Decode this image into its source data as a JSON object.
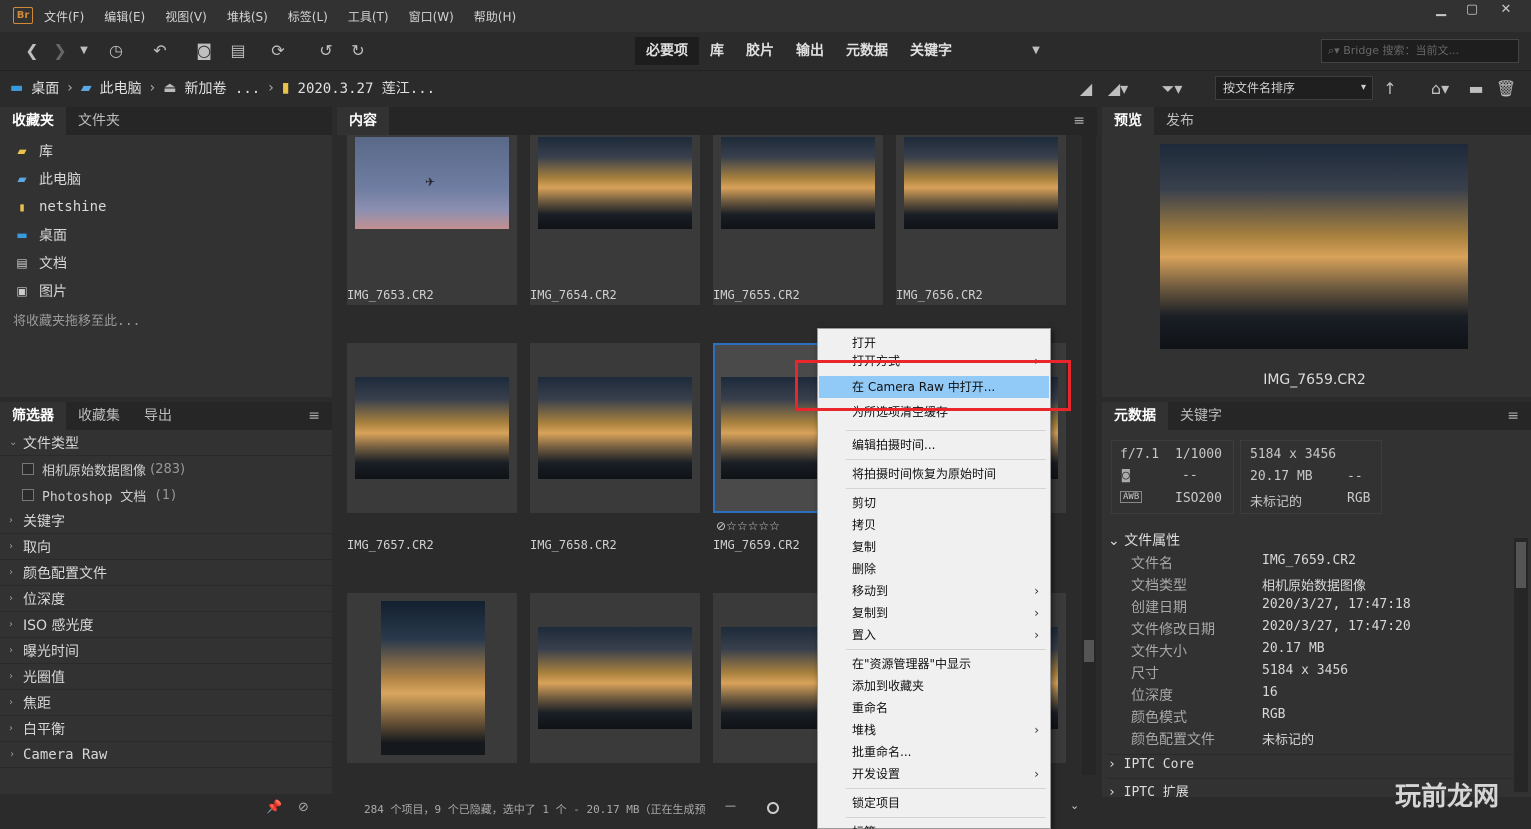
{
  "app": {
    "logo": "Br"
  },
  "menu": [
    "文件(F)",
    "编辑(E)",
    "视图(V)",
    "堆栈(S)",
    "标签(L)",
    "工具(T)",
    "窗口(W)",
    "帮助(H)"
  ],
  "window_controls": {
    "minimize": "▁",
    "maximize": "▢",
    "close": "✕"
  },
  "workspaces": [
    {
      "label": "必要项",
      "active": true
    },
    {
      "label": "库"
    },
    {
      "label": "胶片"
    },
    {
      "label": "输出"
    },
    {
      "label": "元数据"
    },
    {
      "label": "关键字"
    }
  ],
  "search": {
    "placeholder": "Bridge 搜索：当前文..."
  },
  "breadcrumb": [
    "桌面",
    "此电脑",
    "新加卷 ...",
    "2020.3.27 莲江..."
  ],
  "sort": {
    "label": "按文件名排序"
  },
  "left_tabs": [
    "收藏夹",
    "文件夹"
  ],
  "favorites": [
    {
      "icon": "library-icon",
      "label": "库"
    },
    {
      "icon": "computer-icon",
      "label": "此电脑"
    },
    {
      "icon": "folder-icon",
      "label": "netshine"
    },
    {
      "icon": "desktop-icon",
      "label": "桌面"
    },
    {
      "icon": "document-icon",
      "label": "文档"
    },
    {
      "icon": "picture-icon",
      "label": "图片"
    }
  ],
  "fav_hint": "将收藏夹拖移至此...",
  "filter_tabs": [
    "筛选器",
    "收藏集",
    "导出"
  ],
  "filter": {
    "file_type": "文件类型",
    "checkboxes": [
      {
        "label": "相机原始数据图像",
        "count": "(283)"
      },
      {
        "label": "Photoshop 文档",
        "count": "(1)"
      }
    ],
    "groups": [
      "关键字",
      "取向",
      "颜色配置文件",
      "位深度",
      "ISO 感光度",
      "曝光时间",
      "光圈值",
      "焦距",
      "白平衡",
      "Camera Raw"
    ]
  },
  "content_tab": "内容",
  "thumbnails": [
    {
      "name": "IMG_7653.CR2"
    },
    {
      "name": "IMG_7654.CR2"
    },
    {
      "name": "IMG_7655.CR2"
    },
    {
      "name": "IMG_7656.CR2"
    },
    {
      "name": "IMG_7657.CR2"
    },
    {
      "name": "IMG_7658.CR2"
    },
    {
      "name": "IMG_7659.CR2",
      "rating": "⊘☆☆☆☆☆"
    },
    {
      "name": ""
    }
  ],
  "status": "284 个项目，9 个已隐藏，选中了 1 个 - 20.17 MB（正在生成预",
  "preview_tabs": [
    "预览",
    "发布"
  ],
  "preview_name": "IMG_7659.CR2",
  "meta_tabs": [
    "元数据",
    "关键字"
  ],
  "exif": {
    "fstop": "f/7.1",
    "shutter": "1/1000",
    "metering": "--",
    "awb": "AWB",
    "iso": "ISO200",
    "dims": "5184 x 3456",
    "size": "20.17 MB",
    "dash": "--",
    "label": "未标记的",
    "mode": "RGB"
  },
  "file_props_title": "文件属性",
  "file_props": [
    {
      "k": "文件名",
      "v": "IMG_7659.CR2"
    },
    {
      "k": "文档类型",
      "v": "相机原始数据图像"
    },
    {
      "k": "创建日期",
      "v": "2020/3/27, 17:47:18"
    },
    {
      "k": "文件修改日期",
      "v": "2020/3/27, 17:47:20"
    },
    {
      "k": "文件大小",
      "v": "20.17 MB"
    },
    {
      "k": "尺寸",
      "v": "5184 x 3456"
    },
    {
      "k": "位深度",
      "v": "16"
    },
    {
      "k": "颜色模式",
      "v": "RGB"
    },
    {
      "k": "颜色配置文件",
      "v": "未标记的"
    }
  ],
  "meta_sections": [
    "IPTC Core",
    "IPTC 扩展"
  ],
  "context_menu": {
    "items": [
      {
        "label": "打开"
      },
      {
        "label": "打开方式",
        "sub": "›"
      },
      {
        "label": "在 Camera Raw 中打开...",
        "highlight": true
      },
      {
        "label": "为所选项清空缓存"
      },
      {
        "label": "编辑拍摄时间..."
      },
      {
        "label": "将拍摄时间恢复为原始时间"
      },
      {
        "label": "剪切"
      },
      {
        "label": "拷贝"
      },
      {
        "label": "复制"
      },
      {
        "label": "删除"
      },
      {
        "label": "移动到",
        "sub": "›"
      },
      {
        "label": "复制到",
        "sub": "›"
      },
      {
        "label": "置入",
        "sub": "›"
      },
      {
        "label": "在\"资源管理器\"中显示"
      },
      {
        "label": "添加到收藏夹"
      },
      {
        "label": "重命名"
      },
      {
        "label": "堆栈",
        "sub": "›"
      },
      {
        "label": "批重命名..."
      },
      {
        "label": "开发设置",
        "sub": "›"
      },
      {
        "label": "锁定项目"
      },
      {
        "label": "标签",
        "sub": "›"
      }
    ]
  },
  "watermark": "玩前龙网",
  "colors": {
    "highlight": "#91c9f7",
    "red_box": "#e8262b",
    "selection": "#2a6fc0"
  }
}
